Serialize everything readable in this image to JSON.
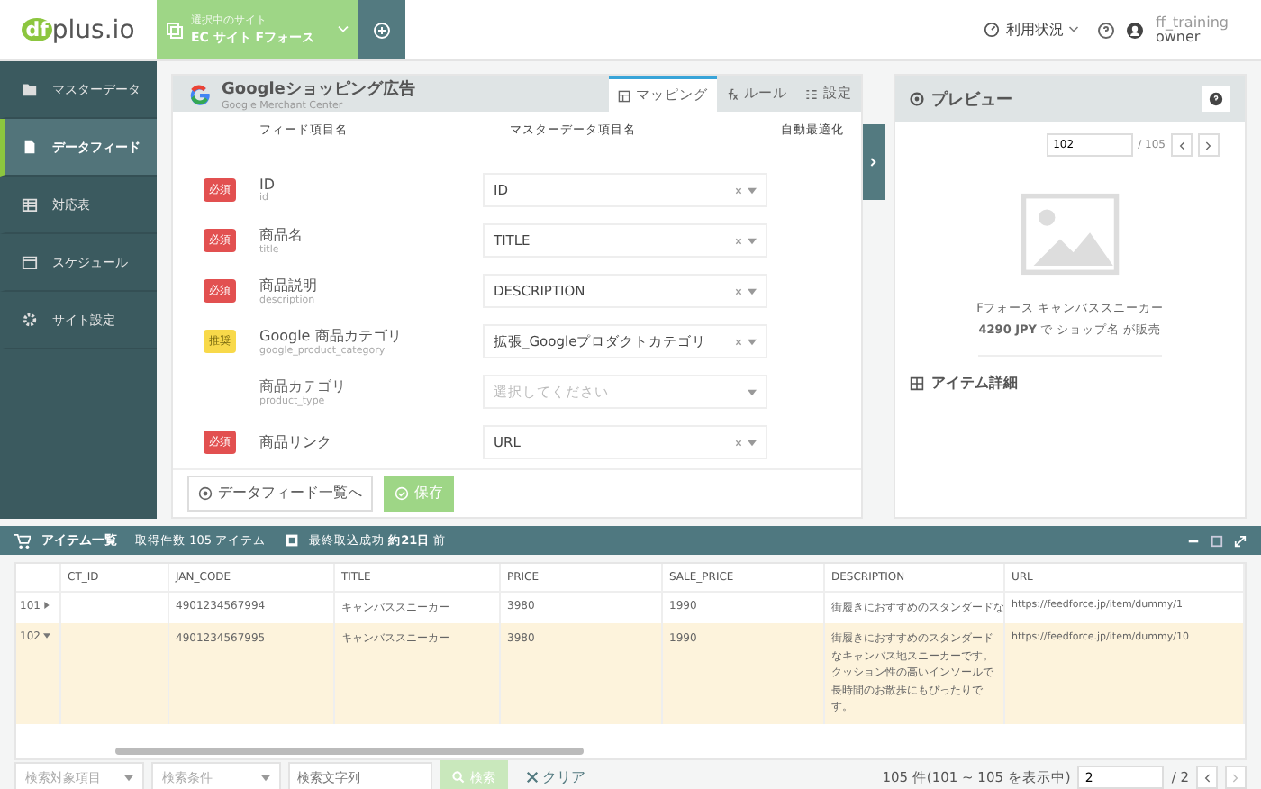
{
  "logo": {
    "mark": "df",
    "text": "plus.io"
  },
  "site_selector": {
    "caption": "選択中のサイト",
    "name": "EC サイト Fフォース"
  },
  "header": {
    "usage": "利用状況",
    "user": "ff_training",
    "role": "owner"
  },
  "sidebar": {
    "items": [
      {
        "label": "マスターデータ",
        "selected": false
      },
      {
        "label": "データフィード",
        "selected": true
      },
      {
        "label": "対応表",
        "selected": false
      },
      {
        "label": "スケジュール",
        "selected": false
      },
      {
        "label": "サイト設定",
        "selected": false
      }
    ]
  },
  "editor": {
    "title": "Googleショッピング広告",
    "subtitle": "Google Merchant Center",
    "tabs": [
      {
        "label": "マッピング",
        "selected": true
      },
      {
        "label": "ルール",
        "selected": false
      },
      {
        "label": "設定",
        "selected": false
      }
    ],
    "columns": [
      "フィード項目名",
      "マスターデータ項目名",
      "自動最適化"
    ],
    "fields": [
      {
        "badge": "必須",
        "kind": "required",
        "label": "ID",
        "key": "id",
        "value": "ID"
      },
      {
        "badge": "必須",
        "kind": "required",
        "label": "商品名",
        "key": "title",
        "value": "TITLE"
      },
      {
        "badge": "必須",
        "kind": "required",
        "label": "商品説明",
        "key": "description",
        "value": "DESCRIPTION"
      },
      {
        "badge": "推奨",
        "kind": "recommended",
        "label": "Google 商品カテゴリ",
        "key": "google_product_category",
        "value": "拡張_Googleプロダクトカテゴリ"
      },
      {
        "kind": "optional",
        "label": "商品カテゴリ",
        "key": "product_type",
        "placeholder": "選択してください"
      },
      {
        "badge": "必須",
        "kind": "required",
        "label": "商品リンク",
        "value": "URL"
      }
    ],
    "buttons": [
      {
        "label": "データフィード一覧へ",
        "kind": "secondary"
      },
      {
        "label": "保存",
        "kind": "primary"
      }
    ]
  },
  "preview": {
    "title": "プレビュー",
    "page": "102",
    "total": "/ 105",
    "product": "Fフォース キャンバススニーカー",
    "price_line": "**4290 JPY** で ショップ名 が販売",
    "section": "アイテム詳細"
  },
  "items": {
    "title": "アイテム一覧",
    "count": "取得件数 105 アイテム",
    "last_import": "最終取込成功 **約21日** 前",
    "table": {
      "columns": [
        "CT_ID",
        "JAN_CODE",
        "TITLE",
        "PRICE",
        "SALE_PRICE",
        "DESCRIPTION",
        "URL"
      ],
      "rows": [
        {
          "number": "101",
          "expanded": false,
          "selected": false,
          "cells": [
            "",
            "4901234567994",
            "キャンバススニーカー",
            "3980",
            "1990",
            "街履きにおすすめのスタンダードな",
            "https://feedforce.jp/item/dummy/1"
          ]
        },
        {
          "number": "102",
          "expanded": true,
          "selected": true,
          "cells": [
            "",
            "4901234567995",
            "キャンバススニーカー",
            "3980",
            "1990",
            "街履きにおすすめのスタンダードなキャンバス地スニーカーです。クッション性の高いインソールで長時間のお散歩にもぴったりです。",
            "https://feedforce.jp/item/dummy/10"
          ]
        }
      ]
    },
    "search": {
      "field_placeholder": "検索対象項目",
      "condition_placeholder": "検索条件",
      "text_placeholder": "検索文字列",
      "button": "検索",
      "clear": "クリア",
      "summary": "105 件(101 ~ 105 を表示中)",
      "page": "2",
      "total": "/ 2"
    }
  }
}
